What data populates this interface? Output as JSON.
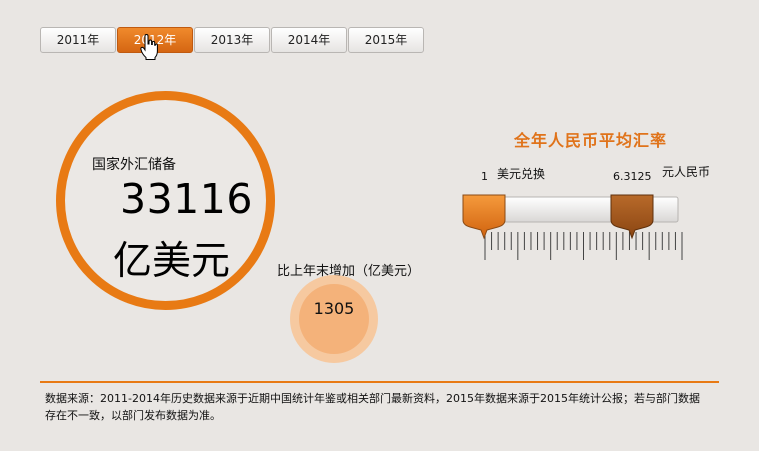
{
  "year_tabs": [
    {
      "label": "2011年"
    },
    {
      "label": "2012年"
    },
    {
      "label": "2013年"
    },
    {
      "label": "2014年"
    },
    {
      "label": "2015年"
    }
  ],
  "active_year_index": 1,
  "reserve": {
    "label": "国家外汇储备",
    "value": "33116",
    "unit": "亿美元"
  },
  "increase": {
    "label": "比上年末增加（亿美元）",
    "value": "1305"
  },
  "exchange_rate": {
    "title": "全年人民币平均汇率",
    "left_number": "1",
    "left_label": "美元兑换",
    "right_number": "6.3125",
    "right_label": "元人民币"
  },
  "footer": {
    "text": "数据来源：2011-2014年历史数据来源于近期中国统计年鉴或相关部门最新资料，2015年数据来源于2015年统计公报；若与部门数据存在不一致，以部门发布数据为准。"
  },
  "colors": {
    "accent": "#e87a14",
    "active_tab": "#e0721a",
    "right_handle": "#9a5018"
  },
  "icons": [
    "hand-cursor-icon"
  ]
}
